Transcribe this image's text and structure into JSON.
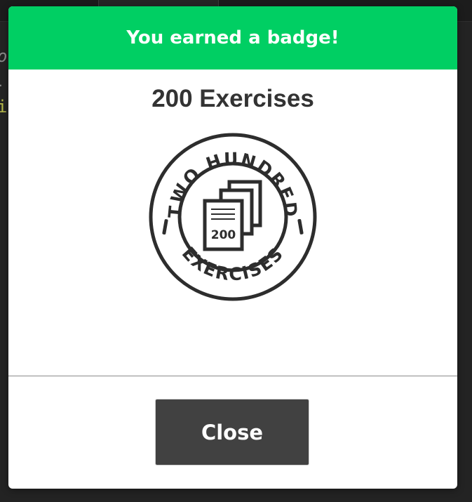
{
  "background": {
    "code_lines": [
      "o",
      ".",
      "i"
    ]
  },
  "modal": {
    "title": "You earned a badge!",
    "badge_name": "200 Exercises",
    "badge": {
      "ring_top_text": "TWO HUNDRED",
      "ring_bottom_text": "EXERCISES",
      "center_number": "200",
      "icon": "stacked-pages-icon"
    },
    "close_label": "Close"
  },
  "colors": {
    "header": "#00cf63",
    "button": "#414141",
    "badge_ink": "#2d2d2d"
  }
}
